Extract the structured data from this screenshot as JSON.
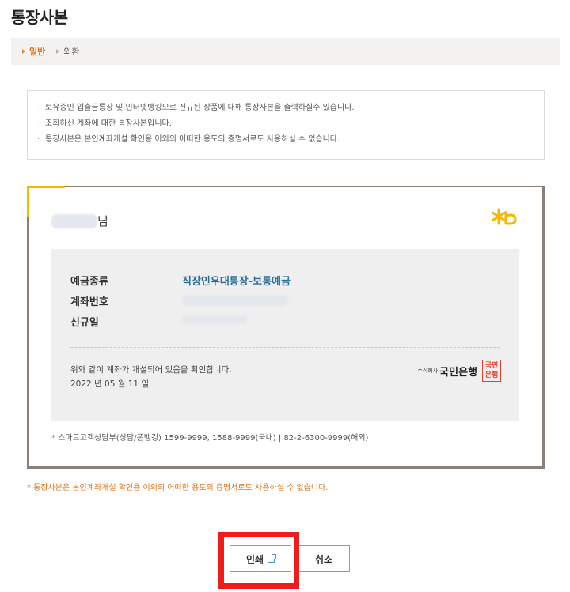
{
  "page": {
    "title": "통장사본"
  },
  "tabs": [
    {
      "label": "일반",
      "active": true
    },
    {
      "label": "외환",
      "active": false
    }
  ],
  "notice": {
    "items": [
      "보유중인 입출금통장 및 인터넷뱅킹으로 신규된 상품에 대해 통장사본을 출력하실수 있습니다.",
      "조회하신 계좌에 대한 통장사본입니다.",
      "통장사본은 본인계좌개설 확인용 이외의 어떠한 용도의 증명서로도 사용하실 수 없습니다."
    ]
  },
  "passbook": {
    "name_suffix": "님",
    "logo_icon": "kb-star-icon",
    "fields": {
      "deposit_type_label": "예금종류",
      "deposit_type_value": "직장인우대통장-보통예금",
      "account_number_label": "계좌번호",
      "open_date_label": "신규일"
    },
    "confirm_text": "위와 같이 계좌가 개설되어 있음을 확인합니다.",
    "confirm_date": "2022 년 05 월 11 일",
    "bank_company": "주식회사",
    "bank_name": "국민은행",
    "seal_line1": "국민",
    "seal_line2": "은행",
    "contact": "스마트고객상담부(상담/폰뱅킹) 1599-9999, 1588-9999(국내) | 82-2-6300-9999(해외)"
  },
  "warning": "* 통장사본은 본인계좌개설 확인용 이외의 어떠한 용도의 증명서로도 사용하실 수 없습니다.",
  "buttons": {
    "print_label": "인쇄",
    "cancel_label": "취소"
  },
  "colors": {
    "accent_orange": "#e0731a",
    "kb_yellow": "#f5b800",
    "value_blue": "#2b6f97",
    "highlight_red": "#ee1c1c"
  }
}
